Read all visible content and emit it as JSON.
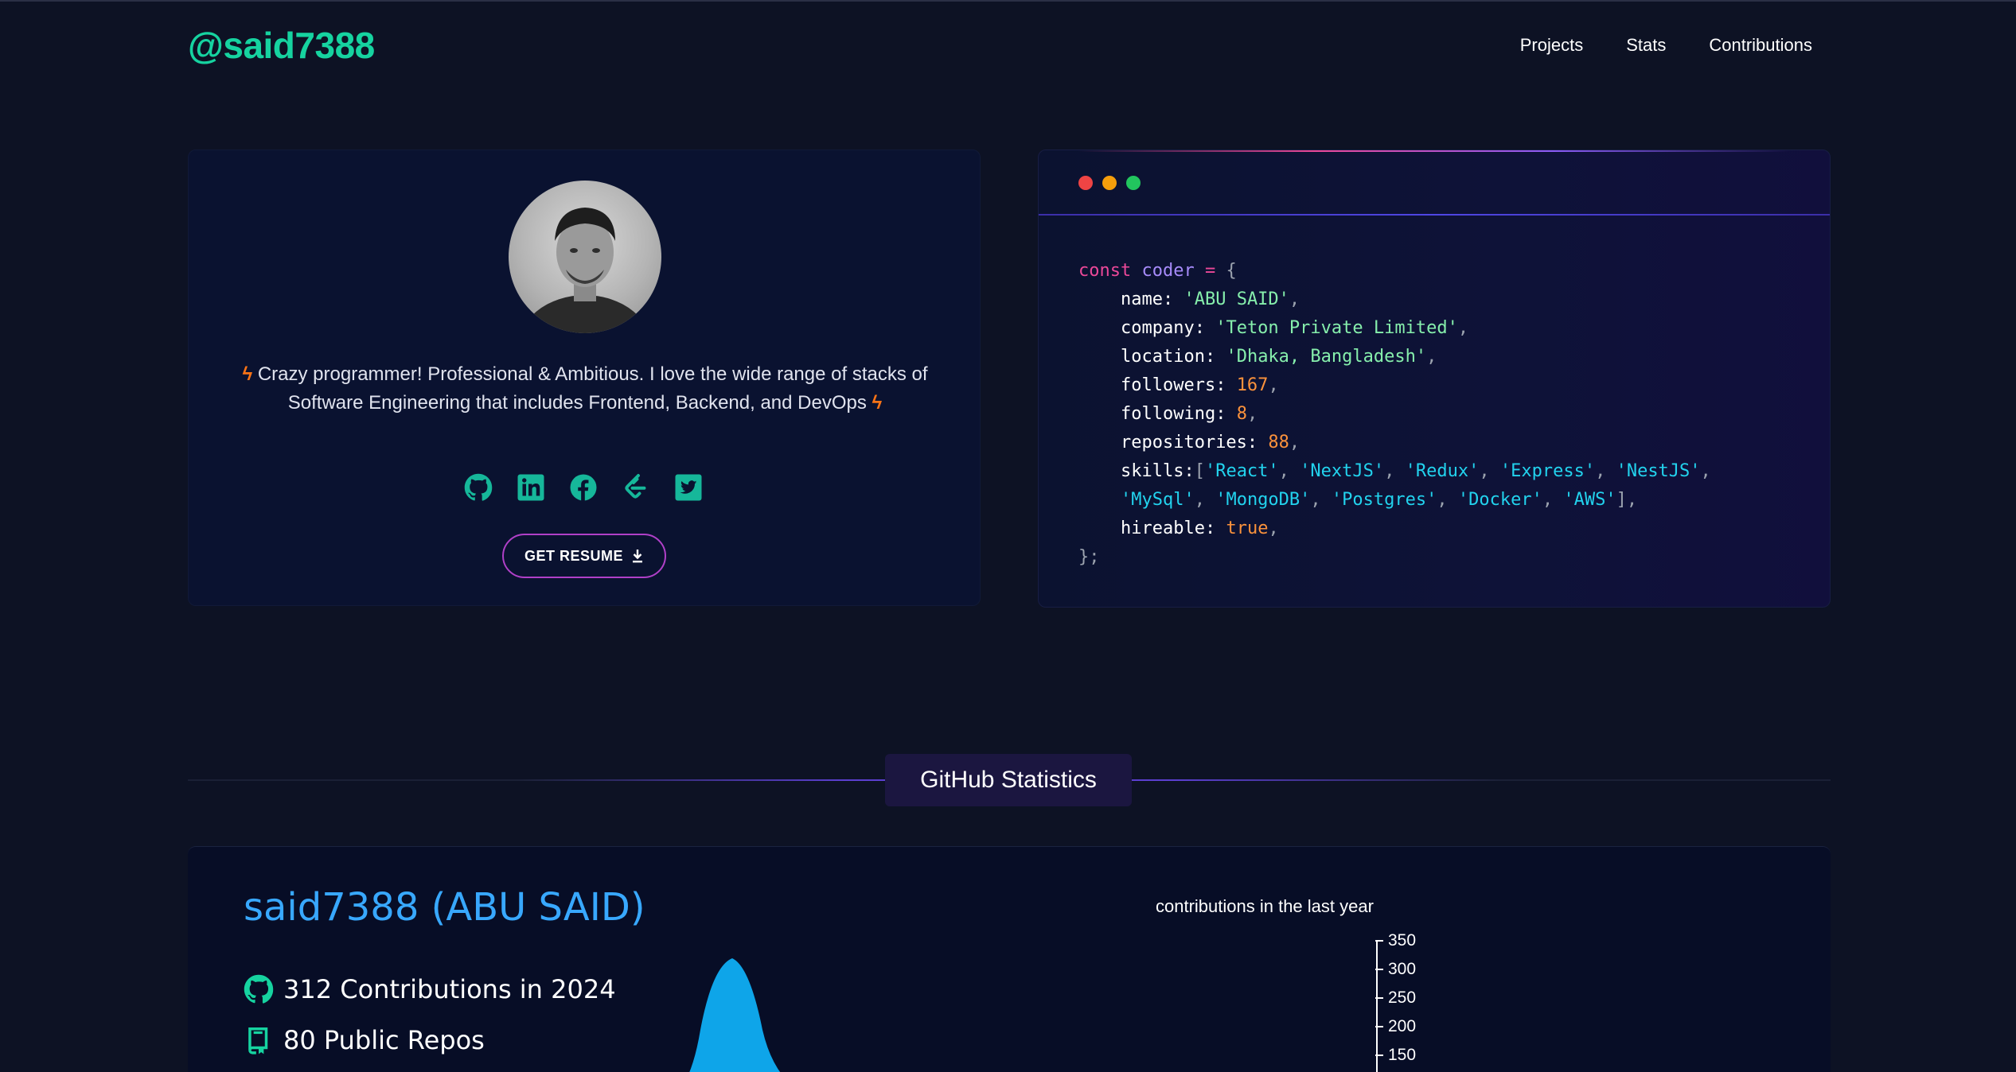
{
  "header": {
    "brand": "@said7388",
    "nav": [
      "Projects",
      "Stats",
      "Contributions"
    ]
  },
  "profile": {
    "bio": "Crazy programmer! Professional & Ambitious. I love the wide range of stacks of Software Engineering that includes Frontend, Backend, and DevOps",
    "socials": [
      "github-icon",
      "linkedin-icon",
      "facebook-icon",
      "leetcode-icon",
      "twitter-icon"
    ],
    "resume_label": "GET RESUME",
    "accent": "#16d3a0"
  },
  "code": {
    "keyword": "const",
    "var_name": "coder",
    "name": "'ABU SAID'",
    "company": "'Teton Private Limited'",
    "location": "'Dhaka, Bangladesh'",
    "followers": "167",
    "following": "8",
    "repositories": "88",
    "skills_row1": [
      "'React'",
      "'NextJS'",
      "'Redux'",
      "'Express'",
      "'NestJS'"
    ],
    "skills_row2": [
      "'MySql'",
      "'MongoDB'",
      "'Postgres'",
      "'Docker'",
      "'AWS'"
    ],
    "hireable": "true"
  },
  "section": {
    "title": "GitHub Statistics"
  },
  "stats": {
    "name": "said7388 (ABU SAID)",
    "contributions": "312 Contributions in 2024",
    "repos": "80 Public Repos",
    "chart_title": "contributions in the last year",
    "y_ticks": [
      "350",
      "300",
      "250",
      "200",
      "150"
    ]
  },
  "colors": {
    "background": "#0d1224",
    "brand": "#16d3a0",
    "name_blue": "#38a8ff",
    "bolt": "#f97316"
  }
}
